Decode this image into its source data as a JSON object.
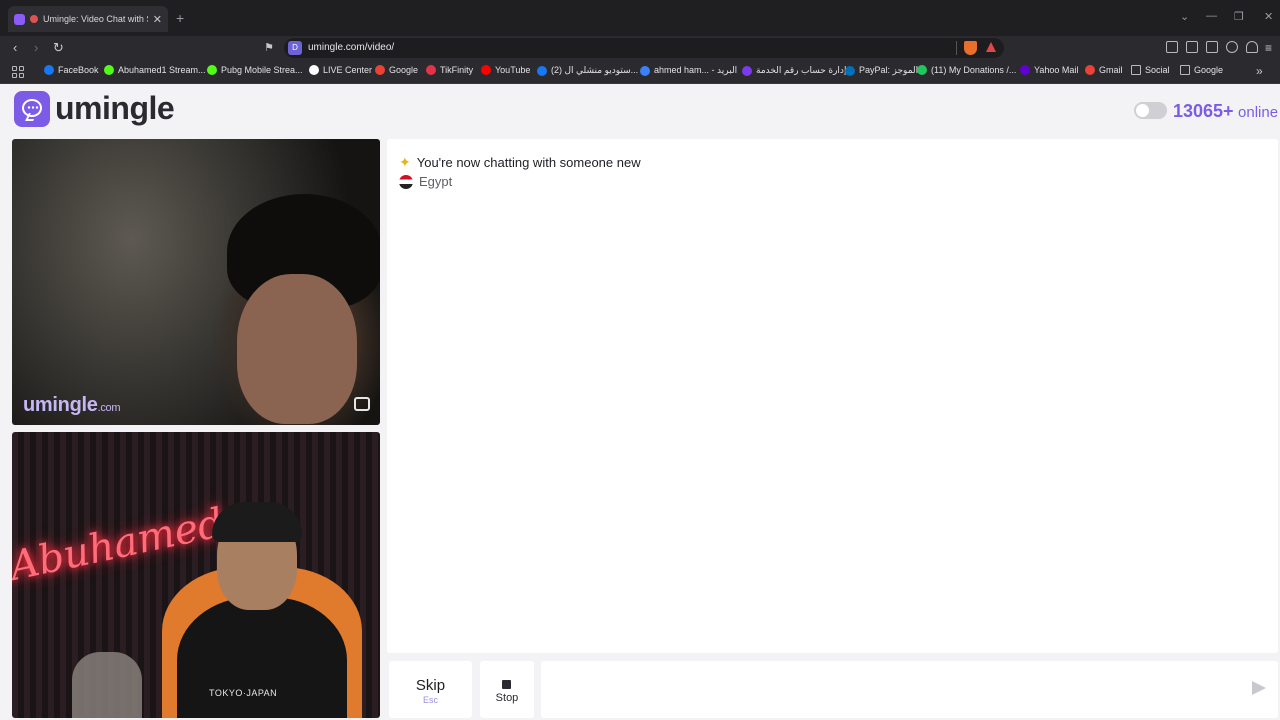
{
  "browser": {
    "tab_title": "Umingle: Video Chat with Str",
    "url": "umingle.com/video/",
    "bookmarks": [
      {
        "label": "FaceBook",
        "color": "#1877f2"
      },
      {
        "label": "Abuhamed1 Stream...",
        "color": "#53fc18"
      },
      {
        "label": "Pubg Mobile Strea...",
        "color": "#53fc18"
      },
      {
        "label": "LIVE Center",
        "color": "#ffffff"
      },
      {
        "label": "Google",
        "color": "#ea4335"
      },
      {
        "label": "TikFinity",
        "color": "#e2334a"
      },
      {
        "label": "YouTube",
        "color": "#ff0000"
      },
      {
        "label": "(2) ستوديو منشلي ال...",
        "color": "#1877f2"
      },
      {
        "label": "ahmed ham... - البريد",
        "color": "#3b82f6"
      },
      {
        "label": "إدارة حساب رقم الخدمة",
        "color": "#7c3aed"
      },
      {
        "label": "PayPal: الموجز",
        "color": "#0070ba"
      },
      {
        "label": "(11) My Donations /...",
        "color": "#22c55e"
      },
      {
        "label": "Yahoo Mail",
        "color": "#6001d2"
      },
      {
        "label": "Gmail",
        "color": "#ea4335"
      },
      {
        "label": "Social",
        "color": "#b8b8bd"
      },
      {
        "label": "Google",
        "color": "#b8b8bd"
      }
    ]
  },
  "header": {
    "logo_text": "umingle",
    "online_count": "13065+",
    "online_label": "online"
  },
  "video": {
    "watermark": "umingle",
    "watermark_domain": ".com",
    "self_shirt_text": "TOKYO·JAPAN"
  },
  "chat": {
    "status_message": "You're now chatting with someone new",
    "country": "Egypt"
  },
  "controls": {
    "skip_label": "Skip",
    "skip_shortcut": "Esc",
    "stop_label": "Stop",
    "message_placeholder": ""
  },
  "colors": {
    "accent": "#7c5ce6",
    "chrome_dark": "#2b2b2f"
  }
}
